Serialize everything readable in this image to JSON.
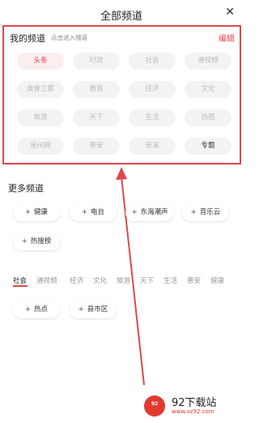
{
  "header": {
    "title": "全部频道",
    "close": "✕"
  },
  "my_channels": {
    "title": "我的频道",
    "hint": "点击进入频道",
    "edit": "编辑",
    "chips": [
      "头条",
      "时政",
      "社会",
      "通视频",
      "美食之都",
      "教育",
      "经济",
      "文化",
      "旅游",
      "天下",
      "生活",
      "热图",
      "泉州网",
      "惠安",
      "安溪",
      "专题"
    ],
    "active": "头条",
    "dark": "专题"
  },
  "more_channels": {
    "title": "更多频道",
    "chips": [
      "健康",
      "电台",
      "东海潮声",
      "音乐云",
      "热搜榜"
    ],
    "plus": "+"
  },
  "tabs": {
    "items": [
      "社会",
      "通视频",
      "经济",
      "文化",
      "旅游",
      "天下",
      "生活",
      "惠安",
      "健康"
    ],
    "active": "社会"
  },
  "sub_chips": [
    "热点",
    "县市区"
  ],
  "watermark": {
    "name": "92下载站",
    "url": "www.xz92.com",
    "badge": "92"
  },
  "colors": {
    "accent": "#e0474c",
    "chip_bg": "#f3f3f3"
  }
}
